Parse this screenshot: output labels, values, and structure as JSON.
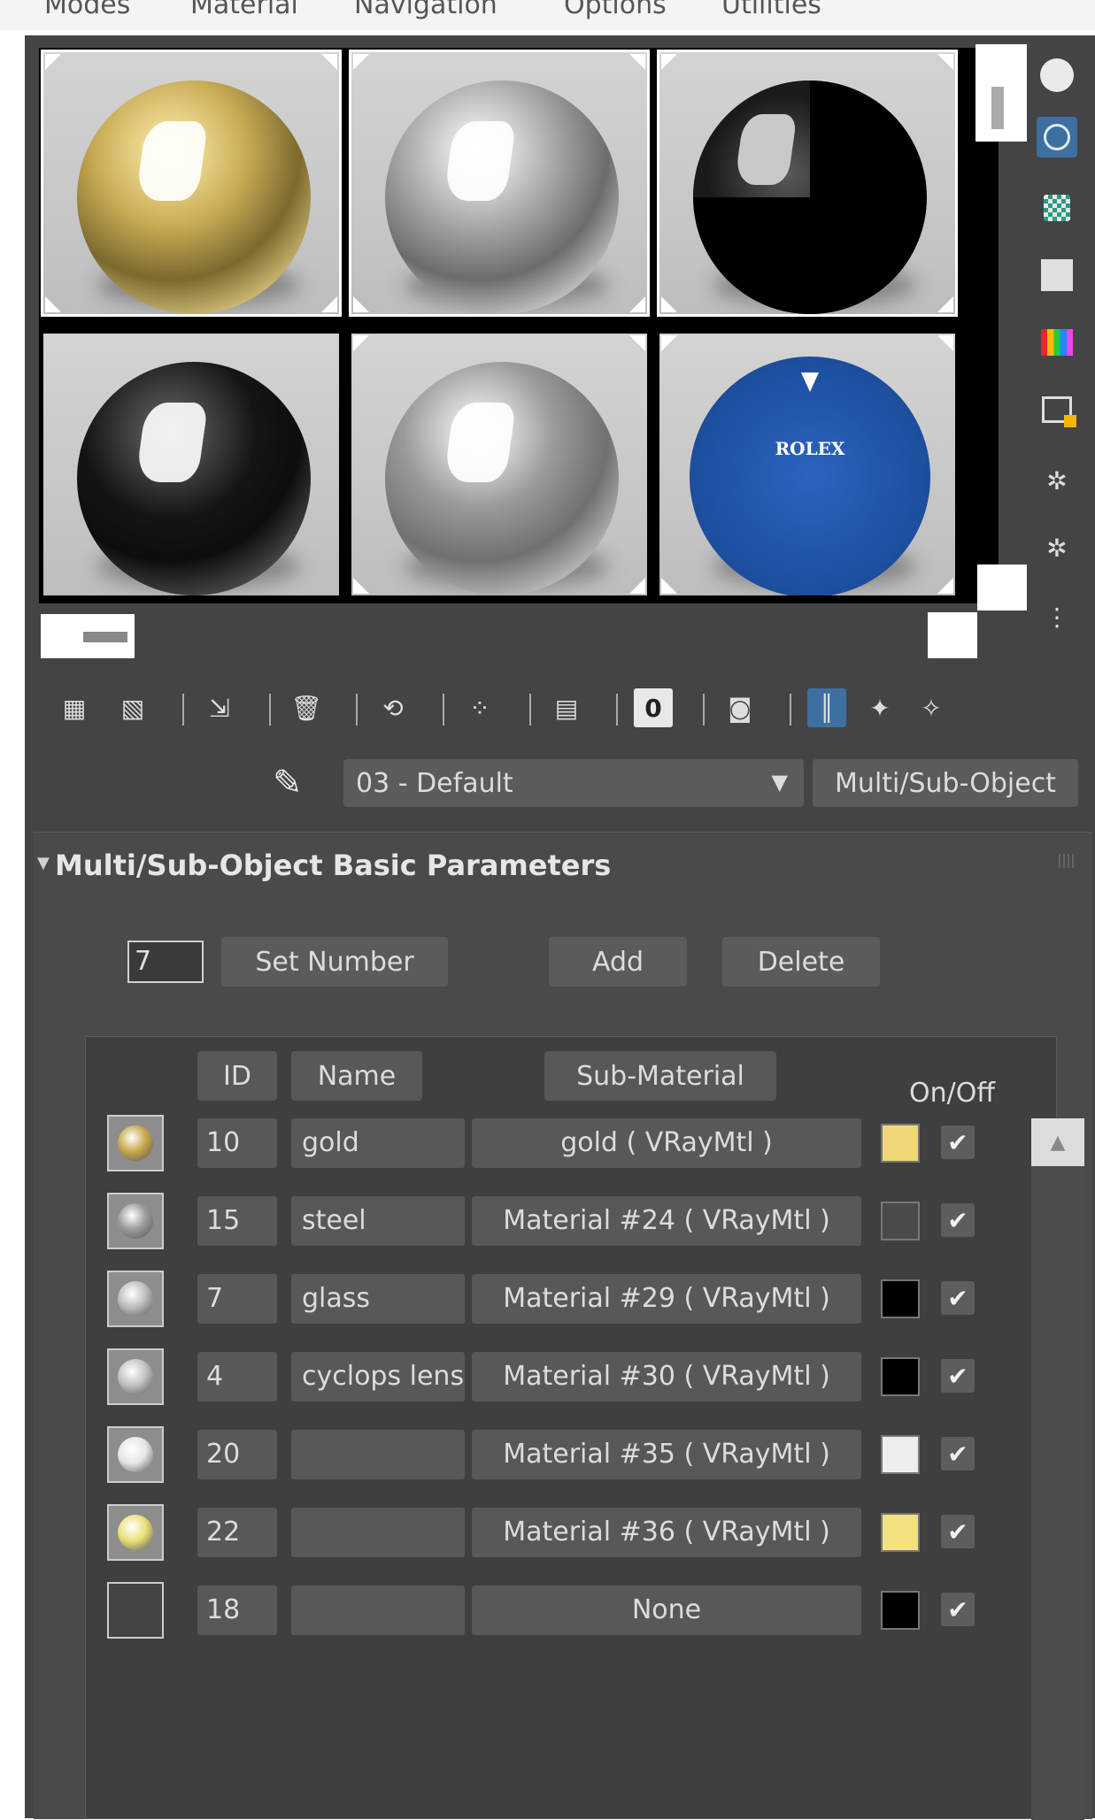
{
  "menu": [
    "Modes",
    "Material",
    "Navigation",
    "Options",
    "Utilities"
  ],
  "preview_slots": [
    {
      "material": "gold",
      "color": "#c8a84a"
    },
    {
      "material": "steel",
      "color": "#9a9a9a"
    },
    {
      "material": "black",
      "color": "#000000"
    },
    {
      "material": "black-gloss",
      "color": "#2a2a2a"
    },
    {
      "material": "grey",
      "color": "#8a8a8a"
    },
    {
      "material": "rolex-dial",
      "color": "#1d4e9e"
    }
  ],
  "dial": {
    "brand": "ROLEX"
  },
  "toolbar": {
    "zero_label": "0"
  },
  "material_selector": {
    "name": "03 - Default",
    "type_button": "Multi/Sub-Object"
  },
  "rollout": {
    "title": "Multi/Sub-Object Basic Parameters",
    "count_value": "7",
    "set_number": "Set Number",
    "add": "Add",
    "delete": "Delete"
  },
  "table": {
    "headers": {
      "id": "ID",
      "name": "Name",
      "sub_material": "Sub-Material",
      "on_off": "On/Off"
    },
    "rows": [
      {
        "id": "10",
        "name": "gold",
        "sub": "gold  ( VRayMtl )",
        "swatch": "#f0d77a",
        "thumb": "#c8a84a",
        "checked": "✔"
      },
      {
        "id": "15",
        "name": "steel",
        "sub": "Material #24  ( VRayMtl )",
        "swatch": "#4a4a4a",
        "thumb": "#9a9a9a",
        "checked": "✔"
      },
      {
        "id": "7",
        "name": "glass",
        "sub": "Material #29  ( VRayMtl )",
        "swatch": "#000000",
        "thumb": "#bdbdbd",
        "checked": "✔"
      },
      {
        "id": "4",
        "name": "cyclops lens",
        "sub": "Material #30  ( VRayMtl )",
        "swatch": "#000000",
        "thumb": "#c2c2c2",
        "checked": "✔"
      },
      {
        "id": "20",
        "name": "",
        "sub": "Material #35  ( VRayMtl )",
        "swatch": "#eeeeee",
        "thumb": "#e6e6e6",
        "checked": "✔"
      },
      {
        "id": "22",
        "name": "",
        "sub": "Material #36  ( VRayMtl )",
        "swatch": "#f3e07f",
        "thumb": "#ebe07a",
        "checked": "✔"
      },
      {
        "id": "18",
        "name": "",
        "sub": "None",
        "swatch": "#000000",
        "thumb": "#444444",
        "checked": "✔"
      }
    ]
  },
  "colors": {
    "panel": "#444444",
    "accent": "#3d6fa0"
  }
}
